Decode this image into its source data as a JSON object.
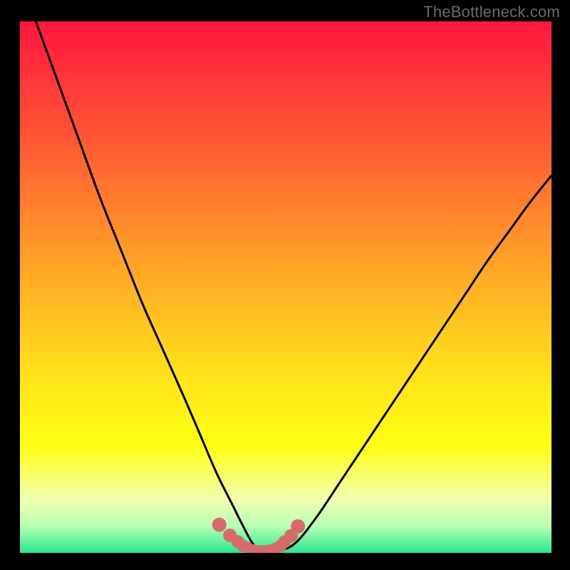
{
  "attribution": "TheBottleneck.com",
  "colors": {
    "gradient_top": "#ff163f",
    "gradient_mid1": "#ff5634",
    "gradient_mid2": "#ff9e28",
    "gradient_mid3": "#ffe31a",
    "gradient_mid4": "#ffff14",
    "gradient_mid5": "#f1ffb1",
    "gradient_mid6": "#b7ffb4",
    "gradient_bottom": "#28e78e",
    "curve": "#000000",
    "dots": "#d76b6c",
    "outer_bg": "#000000"
  },
  "chart_data": {
    "type": "line",
    "title": "",
    "xlabel": "",
    "ylabel": "",
    "xlim": [
      0,
      100
    ],
    "ylim": [
      0,
      100
    ],
    "series": [
      {
        "name": "bottleneck-curve",
        "x": [
          3,
          7,
          11,
          15,
          19,
          23,
          27,
          31,
          34,
          37,
          40,
          42,
          44,
          46,
          49,
          52,
          56,
          60,
          64,
          68,
          72,
          76,
          80,
          84,
          88,
          92,
          96,
          100
        ],
        "y": [
          100,
          89,
          78,
          67,
          57,
          47,
          38,
          29,
          22,
          15,
          9,
          5,
          1.5,
          0.5,
          0.5,
          2,
          7,
          13,
          19,
          25,
          31,
          37,
          43,
          49,
          55,
          60.5,
          66,
          71
        ]
      }
    ],
    "marker_points": {
      "name": "bottom-cluster",
      "x": [
        37.5,
        39.5,
        41,
        42,
        43,
        44,
        45,
        46,
        47,
        48,
        49,
        49.8,
        51,
        52.3
      ],
      "y": [
        5.3,
        3.3,
        2.1,
        1.3,
        0.9,
        0.6,
        0.5,
        0.5,
        0.6,
        0.8,
        1.3,
        2.1,
        3.2,
        5
      ]
    },
    "gradient_stops": [
      {
        "offset": 0,
        "key": "gradient_top"
      },
      {
        "offset": 0.22,
        "key": "gradient_mid1"
      },
      {
        "offset": 0.44,
        "key": "gradient_mid2"
      },
      {
        "offset": 0.67,
        "key": "gradient_mid3"
      },
      {
        "offset": 0.8,
        "key": "gradient_mid4"
      },
      {
        "offset": 0.9,
        "key": "gradient_mid5"
      },
      {
        "offset": 0.95,
        "key": "gradient_mid6"
      },
      {
        "offset": 1.0,
        "key": "gradient_bottom"
      }
    ]
  }
}
